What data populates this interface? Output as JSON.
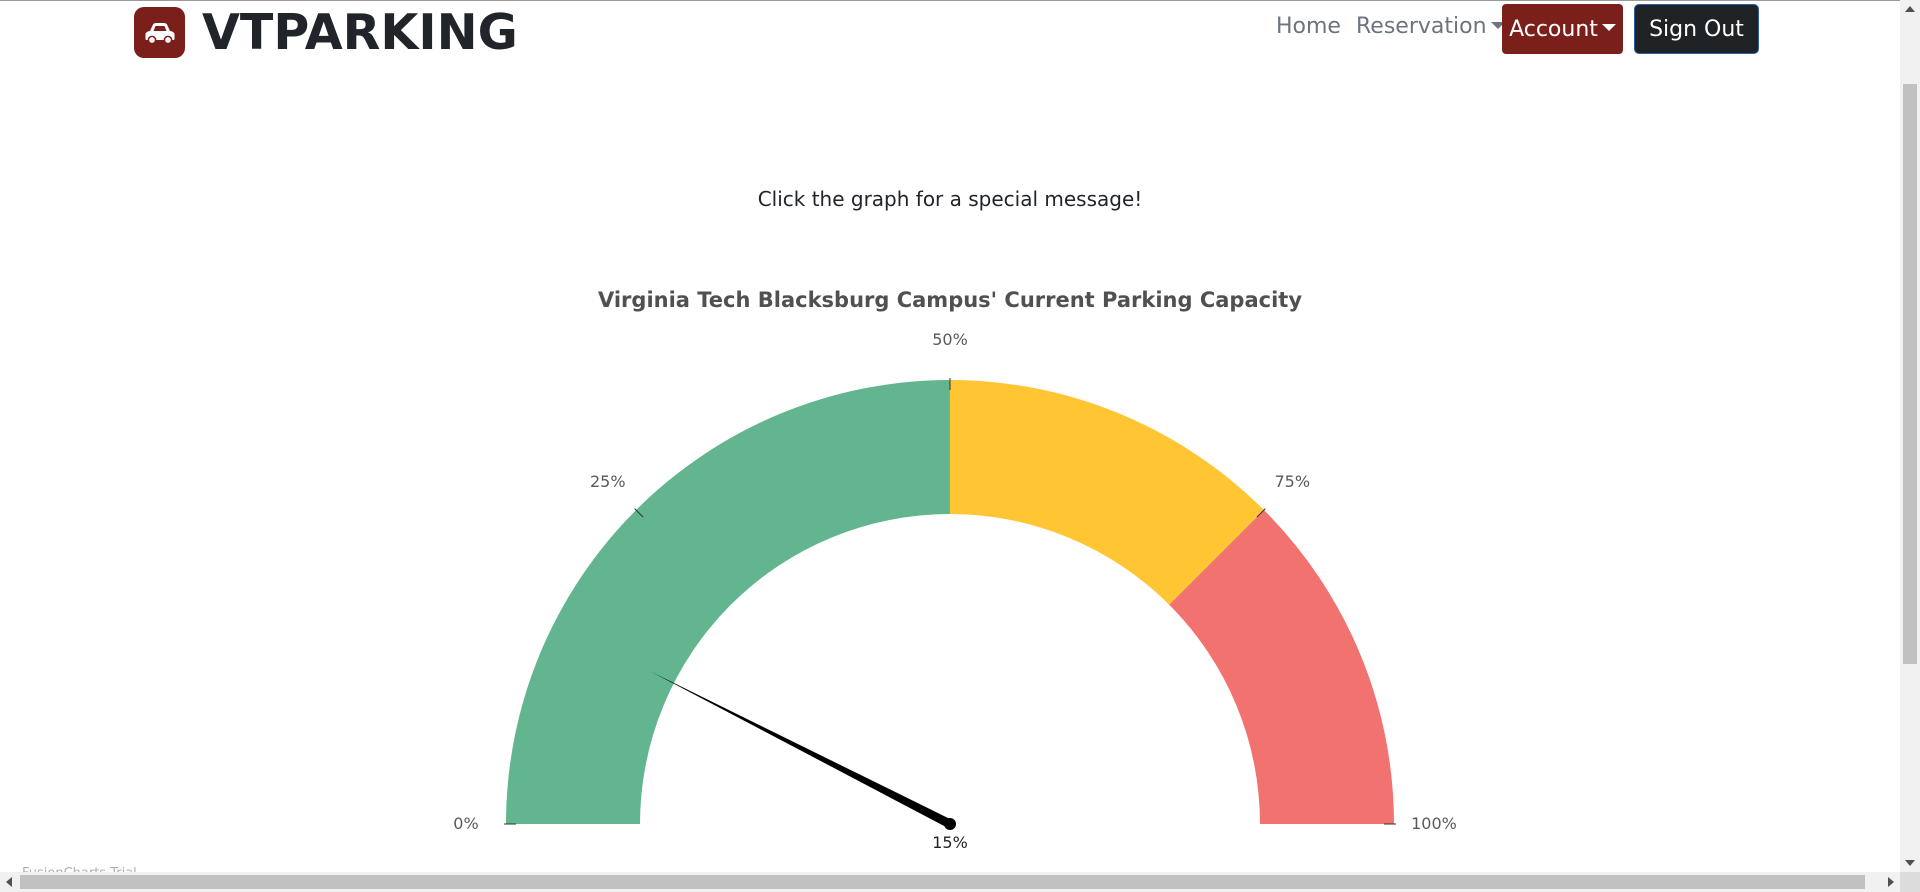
{
  "brand": {
    "name": "VTPARKING",
    "logo_icon": "car-icon",
    "accent_color": "#7a1f1a"
  },
  "nav": {
    "home_label": "Home",
    "reservation_label": "Reservation",
    "account_label": "Account",
    "signout_label": "Sign Out"
  },
  "main": {
    "message": "Click the graph for a special message!"
  },
  "footer": {
    "text": "FusionCharts Trial"
  },
  "chart_data": {
    "type": "gauge",
    "title": "Virginia Tech Blacksburg Campus' Current Parking Capacity",
    "min": 0,
    "max": 100,
    "value": 15,
    "value_label": "15%",
    "ranges": [
      {
        "min": 0,
        "max": 50,
        "color": "#62b58f"
      },
      {
        "min": 50,
        "max": 75,
        "color": "#ffc533"
      },
      {
        "min": 75,
        "max": 100,
        "color": "#f2726f"
      }
    ],
    "tick_values": [
      0,
      25,
      50,
      75,
      100
    ],
    "tick_labels": [
      "0%",
      "25%",
      "50%",
      "75%",
      "100%"
    ]
  }
}
